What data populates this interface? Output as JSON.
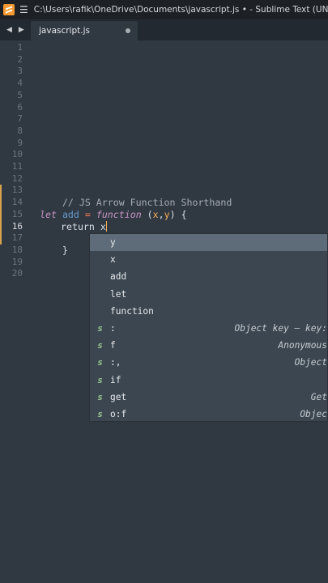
{
  "window": {
    "title": "C:\\Users\\rafik\\OneDrive\\Documents\\javascript.js • - Sublime Text (UNREGISTERED)"
  },
  "tabs": [
    {
      "label": "javascript.js",
      "modified": true
    }
  ],
  "nav": {
    "back": "◀",
    "forward": "▶"
  },
  "editor": {
    "line_numbers": [
      "1",
      "2",
      "3",
      "4",
      "5",
      "6",
      "7",
      "8",
      "9",
      "10",
      "11",
      "12",
      "13",
      "14",
      "15",
      "16",
      "17",
      "18",
      "19",
      "20"
    ],
    "active_line": "16",
    "code": {
      "line13": "// JS Arrow Function Shorthand",
      "line15": {
        "kw": "let",
        "var": "add",
        "op": "=",
        "fn": "function",
        "open": "(",
        "p1": "x",
        "comma": ",",
        "p2": "y",
        "close": ")",
        "brace": "{"
      },
      "line16": {
        "kw": "return",
        "expr": "x"
      },
      "line17": "}"
    }
  },
  "autocomplete": {
    "items": [
      {
        "kind": "",
        "label": "y",
        "hint": ""
      },
      {
        "kind": "",
        "label": "x",
        "hint": ""
      },
      {
        "kind": "",
        "label": "add",
        "hint": ""
      },
      {
        "kind": "",
        "label": "let",
        "hint": ""
      },
      {
        "kind": "",
        "label": "function",
        "hint": ""
      },
      {
        "kind": "s",
        "label": ":",
        "hint": "Object key — key:"
      },
      {
        "kind": "s",
        "label": "f",
        "hint": "Anonymous"
      },
      {
        "kind": "s",
        "label": ":,",
        "hint": "Object"
      },
      {
        "kind": "s",
        "label": "if",
        "hint": ""
      },
      {
        "kind": "s",
        "label": "get",
        "hint": "Get"
      },
      {
        "kind": "s",
        "label": "o:f",
        "hint": "Objec"
      }
    ],
    "selected_index": 0
  },
  "colors": {
    "background": "#303841",
    "titlebar": "#1d2125",
    "selection": "#5e6b78",
    "accent": "#f9ae58"
  }
}
